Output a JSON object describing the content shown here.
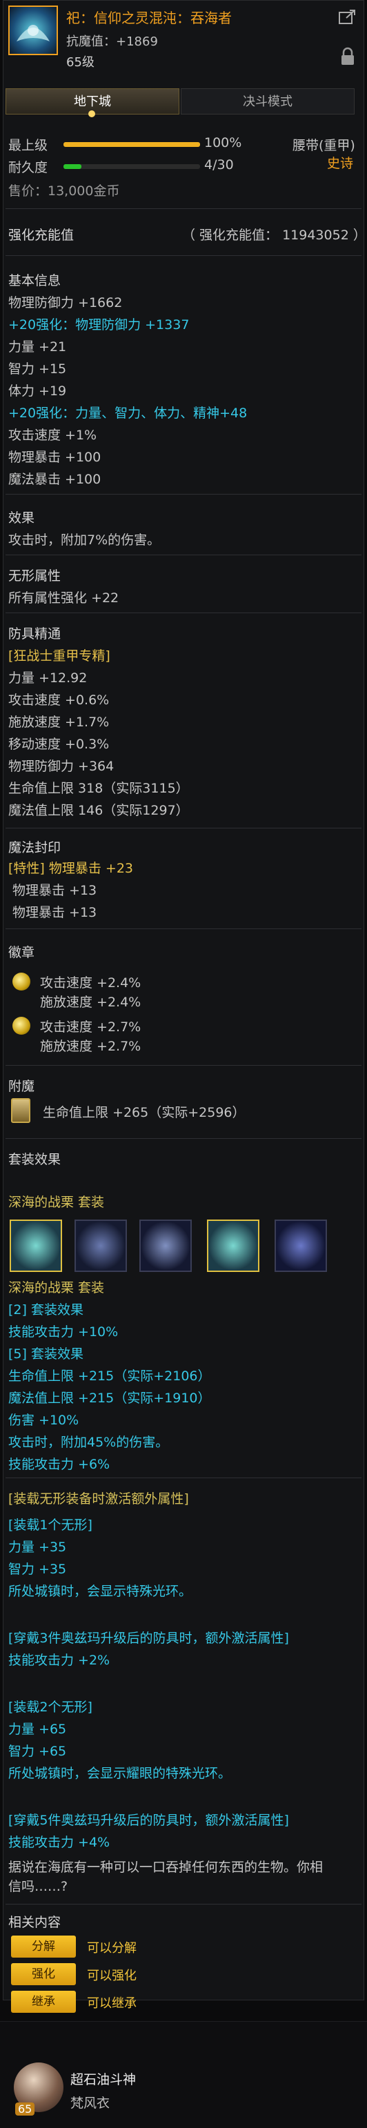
{
  "item": {
    "name": "祀：信仰之灵混沌：吞海者",
    "anti_magic": "抗魔值：+1869",
    "level": "65级"
  },
  "tabs": [
    "地下城",
    "决斗模式"
  ],
  "upgrade": {
    "label": "最上级",
    "percent": "100%",
    "progress": 1.0,
    "type": "腰带(重甲)",
    "rarity": "史诗"
  },
  "durability": {
    "label": "耐久度",
    "value": "4/30",
    "progress": 0.133
  },
  "price": "售价：13,000金币",
  "enhance": {
    "title": "强化充能值",
    "value": "（ 强化充能值： 11943052 ）"
  },
  "basic": {
    "title": "基本信息",
    "lines": [
      {
        "text": "物理防御力 +1662",
        "cls": "grey"
      },
      {
        "text": "+20强化：物理防御力 +1337",
        "cls": "cyan"
      },
      {
        "text": "力量 +21",
        "cls": "grey"
      },
      {
        "text": "智力 +15",
        "cls": "grey"
      },
      {
        "text": "体力 +19",
        "cls": "grey"
      },
      {
        "text": "+20强化：力量、智力、体力、精神+48",
        "cls": "cyan"
      },
      {
        "text": "攻击速度 +1%",
        "cls": "grey"
      },
      {
        "text": "物理暴击 +100",
        "cls": "grey"
      },
      {
        "text": "魔法暴击 +100",
        "cls": "grey"
      }
    ]
  },
  "effect": {
    "title": "效果",
    "text": "攻击时，附加7%的伤害。"
  },
  "formless": {
    "title": "无形属性",
    "text": "所有属性强化 +22"
  },
  "mastery": {
    "title": "防具精通",
    "lines": [
      "[狂战士重甲专精]",
      "力量 +12.92",
      "攻击速度 +0.6%",
      "施放速度 +1.7%",
      "移动速度 +0.3%",
      "物理防御力 +364",
      "生命值上限 318（实际3115）",
      "魔法值上限 146（实际1297）"
    ]
  },
  "seal": {
    "title": "魔法封印",
    "special": "[特性] 物理暴击 +23",
    "lines": [
      "物理暴击 +13",
      "物理暴击 +13"
    ]
  },
  "emblem": {
    "title": "徽章",
    "groups": [
      [
        "攻击速度 +2.4%",
        "施放速度 +2.4%"
      ],
      [
        "攻击速度 +2.7%",
        "施放速度 +2.7%"
      ]
    ]
  },
  "enchant": {
    "title": "附魔",
    "text": "生命值上限 +265（实际+2596）"
  },
  "set": {
    "title": "套装效果",
    "name": "深海的战栗  套装",
    "name2": "深海的战栗  套装",
    "lines": [
      {
        "text": "[2] 套装效果",
        "cls": "cyan"
      },
      {
        "text": "技能攻击力 +10%",
        "cls": "cyan"
      },
      {
        "text": "[5] 套装效果",
        "cls": "cyan"
      },
      {
        "text": "生命值上限 +215（实际+2106）",
        "cls": "cyan"
      },
      {
        "text": "魔法值上限 +215（实际+1910）",
        "cls": "cyan"
      },
      {
        "text": "伤害 +10%",
        "cls": "cyan"
      },
      {
        "text": "攻击时，附加45%的伤害。",
        "cls": "cyan"
      },
      {
        "text": "技能攻击力 +6%",
        "cls": "cyan"
      }
    ]
  },
  "formless_set": {
    "title": "[装载无形装备时激活额外属性]",
    "blocks": [
      [
        "[装载1个无形]",
        "力量 +35",
        "智力 +35",
        "所处城镇时，会显示特殊光环。"
      ],
      [
        "[穿戴3件奥兹玛升级后的防具时，额外激活属性]",
        "技能攻击力 +2%"
      ],
      [
        "[装载2个无形]",
        "力量 +65",
        "智力 +65",
        "所处城镇时，会显示耀眼的特殊光环。"
      ],
      [
        "[穿戴5件奥兹玛升级后的防具时，额外激活属性]",
        "技能攻击力 +4%"
      ]
    ]
  },
  "flavor": [
    "据说在海底有一种可以一口吞掉任何东西的生物。你相",
    "信吗……?"
  ],
  "related": {
    "title": "相关内容",
    "buttons": [
      {
        "label": "分解",
        "desc": "可以分解"
      },
      {
        "label": "强化",
        "desc": "可以强化"
      },
      {
        "label": "继承",
        "desc": "可以继承"
      }
    ]
  },
  "footer": {
    "avatar_level": "65",
    "name": "超石油斗神",
    "sub": "梵风衣"
  },
  "colors": {
    "accent": "#f0a020",
    "cyan": "#36c8e6",
    "gold": "#e6c04a"
  }
}
